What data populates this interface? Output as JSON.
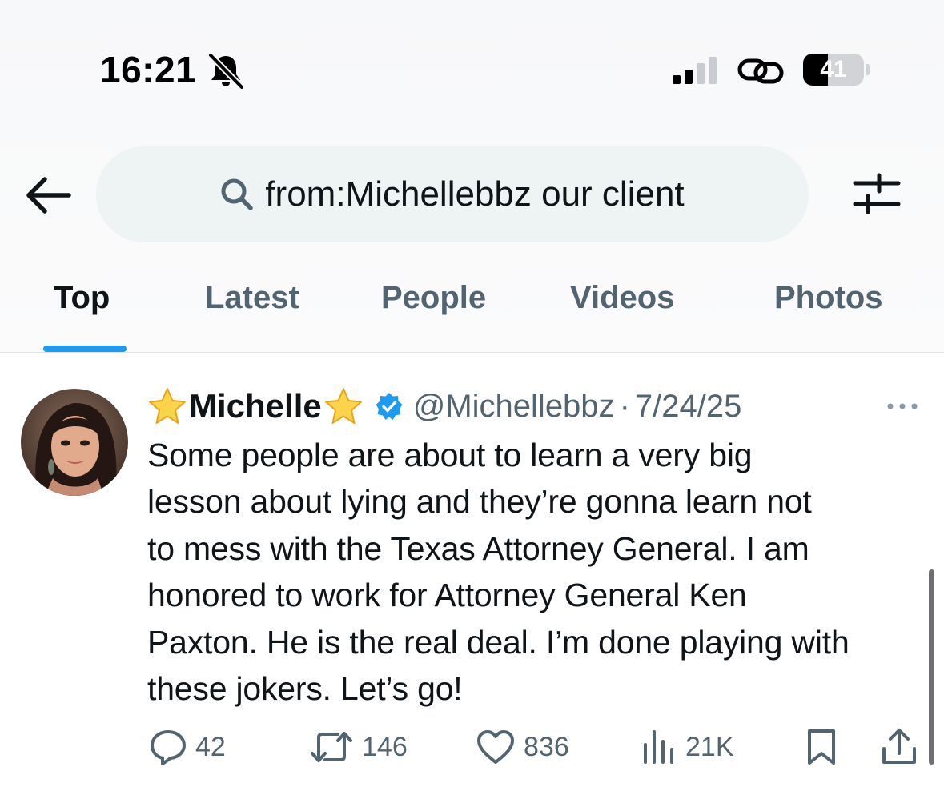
{
  "status_bar": {
    "time": "16:21",
    "battery_level": "41",
    "battery_fraction": 0.41,
    "signal_bars_active": 2,
    "signal_bars_total": 4,
    "icons": [
      "bell-slash-icon",
      "signal-icon",
      "link-icon",
      "battery-icon"
    ]
  },
  "search": {
    "query": "from:Michellebbz our client",
    "icons": [
      "back-arrow-icon",
      "search-icon",
      "filter-sliders-icon"
    ]
  },
  "tabs": [
    {
      "label": "Top",
      "active": true
    },
    {
      "label": "Latest",
      "active": false
    },
    {
      "label": "People",
      "active": false
    },
    {
      "label": "Videos",
      "active": false
    },
    {
      "label": "Photos",
      "active": false
    }
  ],
  "tweet": {
    "display_name": "Michelle",
    "name_emoji": "star",
    "verified": true,
    "handle": "@Michellebbz",
    "separator": "·",
    "date": "7/24/25",
    "lines": [
      "Some people are about to learn a very big",
      "lesson about lying and they’re gonna learn not",
      "to mess with the Texas Attorney General. I am",
      "honored to work for Attorney General Ken",
      "Paxton. He is the real deal. I’m done playing with",
      "these jokers. Let’s go!"
    ],
    "stats": {
      "replies": "42",
      "reposts": "146",
      "likes": "836",
      "views": "21K"
    }
  },
  "colors": {
    "accent": "#1d9bf0",
    "text_primary": "#0f1419",
    "text_secondary": "#536471",
    "search_bg": "#eef3f4",
    "verified": "#1d9bf0"
  }
}
